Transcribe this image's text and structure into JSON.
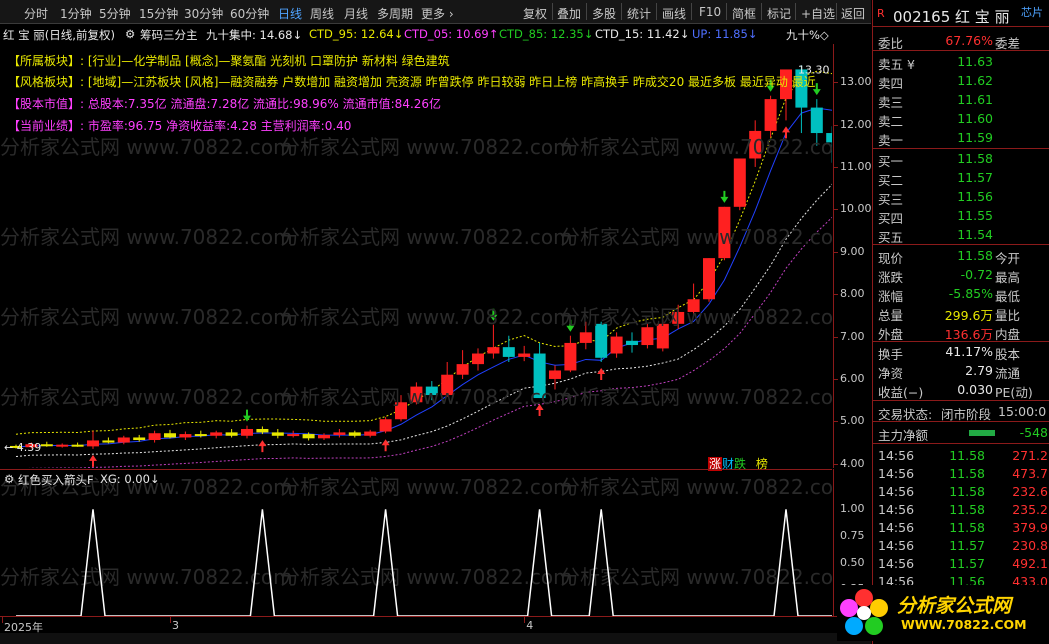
{
  "toolbar": {
    "left": [
      "分时",
      "1分钟",
      "5分钟",
      "15分钟",
      "30分钟",
      "60分钟",
      "日线",
      "周线",
      "月线",
      "多周期",
      "更多 ›"
    ],
    "active_index": 6,
    "right": [
      "复权",
      "叠加",
      "多股",
      "统计",
      "画线",
      "F10",
      "简框",
      "标记",
      "+自选",
      "返回"
    ]
  },
  "titlebar": {
    "name": "红 宝 丽(日线,前复权)",
    "formula": "筹码三分主",
    "items": [
      {
        "text": "九十集中: 14.68↓",
        "color": "#e8e8e8"
      },
      {
        "text": "CTD_95: 12.64↓",
        "color": "#e8e800"
      },
      {
        "text": "CTD_05: 10.69↑",
        "color": "#ff40ff"
      },
      {
        "text": "CTD_85: 12.35↓",
        "color": "#22cc22"
      },
      {
        "text": "CTD_15: 11.42↓",
        "color": "#e8e8e8"
      },
      {
        "text": "UP: 11.85↓",
        "color": "#4f6fff"
      },
      {
        "text": "九十%◇",
        "color": "#e8e8e8"
      }
    ]
  },
  "info": [
    {
      "label": "【所属板块】:",
      "text": "[行业]—化学制品 [概念]—聚氨酯 光刻机 口罩防护 新材料 绿色建筑",
      "label_color": "#e8e800",
      "color": "#e8e800"
    },
    {
      "label": "【风格板块】:",
      "text": "[地域]—江苏板块 [风格]—融资融券 户数增加 融资增加 壳资源 昨曾跌停 昨日较弱 昨日上榜 昨高换手 昨成交20 最近多板 最近异动 最近",
      "label_color": "#e8e800",
      "color": "#e8e800"
    },
    {
      "label": "【股本市值】:",
      "text": "总股本:7.35亿 流通盘:7.28亿 流通比:98.96% 流通市值:84.26亿",
      "label_color": "#ff40ff",
      "color": "#ff40ff"
    },
    {
      "label": "【当前业绩】:",
      "text": "市盈率:96.75 净资收益率:4.28 主营利润率:0.40",
      "label_color": "#ff40ff",
      "color": "#ff40ff"
    }
  ],
  "chart_data": [
    {
      "type": "candlestick",
      "title": "红 宝 丽(日线,前复权)",
      "ylim": [
        3.9,
        13.9
      ],
      "yticks": [
        4.0,
        5.0,
        6.0,
        7.0,
        8.0,
        9.0,
        10.0,
        11.0,
        12.0,
        13.0
      ],
      "annotations": [
        {
          "text": "13.30",
          "price": 13.3,
          "bar": 50
        },
        {
          "text": "← 4.39",
          "price": 4.39,
          "bar": 0
        }
      ],
      "candles": [
        [
          4.42,
          4.45,
          4.36,
          4.39
        ],
        [
          4.39,
          4.5,
          4.36,
          4.46
        ],
        [
          4.46,
          4.52,
          4.4,
          4.43
        ],
        [
          4.43,
          4.48,
          4.38,
          4.45
        ],
        [
          4.45,
          4.5,
          4.4,
          4.41
        ],
        [
          4.41,
          4.78,
          4.35,
          4.55
        ],
        [
          4.55,
          4.62,
          4.48,
          4.5
        ],
        [
          4.5,
          4.66,
          4.46,
          4.62
        ],
        [
          4.62,
          4.68,
          4.52,
          4.56
        ],
        [
          4.56,
          4.78,
          4.5,
          4.72
        ],
        [
          4.72,
          4.8,
          4.6,
          4.62
        ],
        [
          4.62,
          4.76,
          4.56,
          4.7
        ],
        [
          4.7,
          4.78,
          4.62,
          4.66
        ],
        [
          4.66,
          4.78,
          4.6,
          4.74
        ],
        [
          4.74,
          4.82,
          4.62,
          4.66
        ],
        [
          4.66,
          4.9,
          4.6,
          4.82
        ],
        [
          4.82,
          4.88,
          4.7,
          4.74
        ],
        [
          4.74,
          4.82,
          4.6,
          4.66
        ],
        [
          4.66,
          4.78,
          4.62,
          4.7
        ],
        [
          4.7,
          4.74,
          4.55,
          4.6
        ],
        [
          4.6,
          4.72,
          4.56,
          4.68
        ],
        [
          4.68,
          4.82,
          4.62,
          4.74
        ],
        [
          4.74,
          4.78,
          4.62,
          4.66
        ],
        [
          4.66,
          4.8,
          4.62,
          4.76
        ],
        [
          4.76,
          5.1,
          4.72,
          5.05
        ],
        [
          5.05,
          5.62,
          5.0,
          5.45
        ],
        [
          5.45,
          5.92,
          5.4,
          5.82
        ],
        [
          5.82,
          5.95,
          5.5,
          5.62
        ],
        [
          5.62,
          6.4,
          5.58,
          6.1
        ],
        [
          6.1,
          6.68,
          6.0,
          6.35
        ],
        [
          6.35,
          6.72,
          6.2,
          6.6
        ],
        [
          6.6,
          7.28,
          6.48,
          6.75
        ],
        [
          6.75,
          7.02,
          6.4,
          6.52
        ],
        [
          6.52,
          6.78,
          6.42,
          6.6
        ],
        [
          6.6,
          6.85,
          5.55,
          5.55
        ],
        [
          6.0,
          6.32,
          5.75,
          6.2
        ],
        [
          6.2,
          7.02,
          6.16,
          6.85
        ],
        [
          6.85,
          7.35,
          6.7,
          7.1
        ],
        [
          7.3,
          7.35,
          6.4,
          6.5
        ],
        [
          6.6,
          7.1,
          6.5,
          7.0
        ],
        [
          6.9,
          7.1,
          6.62,
          6.8
        ],
        [
          6.8,
          7.32,
          6.72,
          7.22
        ],
        [
          6.72,
          7.4,
          6.65,
          7.3
        ],
        [
          7.3,
          7.75,
          7.18,
          7.58
        ],
        [
          7.58,
          8.25,
          7.52,
          7.88
        ],
        [
          7.88,
          8.85,
          7.82,
          8.85
        ],
        [
          8.85,
          10.06,
          8.8,
          10.06
        ],
        [
          10.06,
          11.2,
          9.98,
          11.2
        ],
        [
          11.2,
          12.1,
          11.0,
          11.85
        ],
        [
          11.85,
          12.68,
          11.7,
          12.6
        ],
        [
          12.6,
          13.3,
          12.1,
          13.3
        ],
        [
          13.3,
          13.4,
          11.8,
          12.4
        ],
        [
          12.4,
          12.6,
          11.5,
          11.8
        ],
        [
          11.8,
          11.96,
          11.1,
          11.58
        ]
      ]
    },
    {
      "type": "line",
      "title": "红色买入箭头F XG: 0.00↓",
      "ylim": [
        0,
        1.2
      ],
      "yticks": [
        0.0,
        0.25,
        0.5,
        0.75,
        1.0
      ],
      "spikes_at_bar": [
        5,
        16,
        24,
        34,
        38,
        50
      ]
    }
  ],
  "subtitle": {
    "name": "红色买入箭头F",
    "value": "XG: 0.00↓"
  },
  "date_axis": [
    {
      "label": "2025年",
      "bar": 0
    },
    {
      "label": "3",
      "bar": 10
    },
    {
      "label": "4",
      "bar": 33
    }
  ],
  "bottom_flags": [
    "涨",
    "财",
    "跌",
    "榜"
  ],
  "panel": {
    "code": "002165 红 宝 丽",
    "link": "芯片",
    "weibi": {
      "label": "委比",
      "value": "67.76%",
      "right": "委差"
    },
    "asks": [
      {
        "label": "卖五 ¥",
        "price": "11.63"
      },
      {
        "label": "卖四",
        "price": "11.62"
      },
      {
        "label": "卖三",
        "price": "11.61"
      },
      {
        "label": "卖二",
        "price": "11.60"
      },
      {
        "label": "卖一",
        "price": "11.59"
      }
    ],
    "bids": [
      {
        "label": "买一",
        "price": "11.58"
      },
      {
        "label": "买二",
        "price": "11.57"
      },
      {
        "label": "买三",
        "price": "11.56"
      },
      {
        "label": "买四",
        "price": "11.55"
      },
      {
        "label": "买五",
        "price": "11.54"
      }
    ],
    "quote": [
      {
        "label": "现价",
        "value": "11.58",
        "right": "今开",
        "color": "#22cc22"
      },
      {
        "label": "涨跌",
        "value": "-0.72",
        "right": "最高",
        "color": "#22cc22"
      },
      {
        "label": "涨幅",
        "value": "-5.85%",
        "right": "最低",
        "color": "#22cc22"
      },
      {
        "label": "总量",
        "value": "299.6万",
        "right": "量比",
        "color": "#e8e800"
      },
      {
        "label": "外盘",
        "value": "136.6万",
        "right": "内盘",
        "color": "#ff3030"
      }
    ],
    "stats": [
      {
        "label": "换手",
        "value": "41.17%",
        "right": "股本"
      },
      {
        "label": "净资",
        "value": "2.79",
        "right": "流通"
      },
      {
        "label": "收益(−)",
        "value": "0.030",
        "right": "PE(动)"
      }
    ],
    "status": {
      "label": "交易状态:",
      "value": "闭市阶段",
      "time": "15:00:0"
    },
    "net_flow": {
      "label": "主力净额",
      "value": "-548"
    },
    "ticks": [
      {
        "time": "14:56",
        "price": "11.58",
        "vol": "271.2"
      },
      {
        "time": "14:56",
        "price": "11.58",
        "vol": "473.7"
      },
      {
        "time": "14:56",
        "price": "11.58",
        "vol": "232.6"
      },
      {
        "time": "14:56",
        "price": "11.58",
        "vol": "235.2"
      },
      {
        "time": "14:56",
        "price": "11.58",
        "vol": "379.9"
      },
      {
        "time": "14:56",
        "price": "11.57",
        "vol": "230.8"
      },
      {
        "time": "14:56",
        "price": "11.57",
        "vol": "492.1"
      },
      {
        "time": "14:56",
        "price": "11.56",
        "vol": "433.0"
      }
    ]
  },
  "watermark": {
    "text": "分析家公式网",
    "url": "WWW.70822.COM"
  },
  "colors": {
    "up": "#ff2020",
    "down": "#00c0c0",
    "axis": "#8b1a1a",
    "accent": "#4fa3ff",
    "flat": "#e8e800"
  }
}
